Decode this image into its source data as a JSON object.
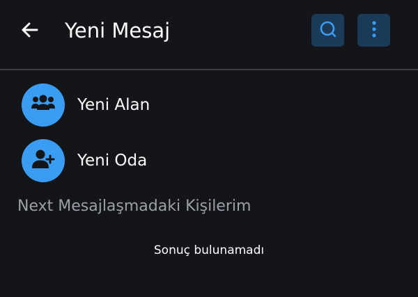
{
  "header": {
    "title": "Yeni Mesaj",
    "back_icon": "arrow-left-icon",
    "search_icon": "search-icon",
    "more_icon": "more-vertical-icon"
  },
  "actions": [
    {
      "label": "Yeni Alan",
      "icon": "group-icon"
    },
    {
      "label": "Yeni Oda",
      "icon": "add-person-icon"
    }
  ],
  "contacts": {
    "section_title": "Next Mesajlaşmadaki Kişilerim",
    "empty_text": "Sonuç bulunamadı"
  },
  "colors": {
    "background": "#141518",
    "accent": "#3b9cf3",
    "icon_button_bg": "#1b3a57",
    "divider": "#3a3d45",
    "secondary_text": "#9aa0a8"
  }
}
